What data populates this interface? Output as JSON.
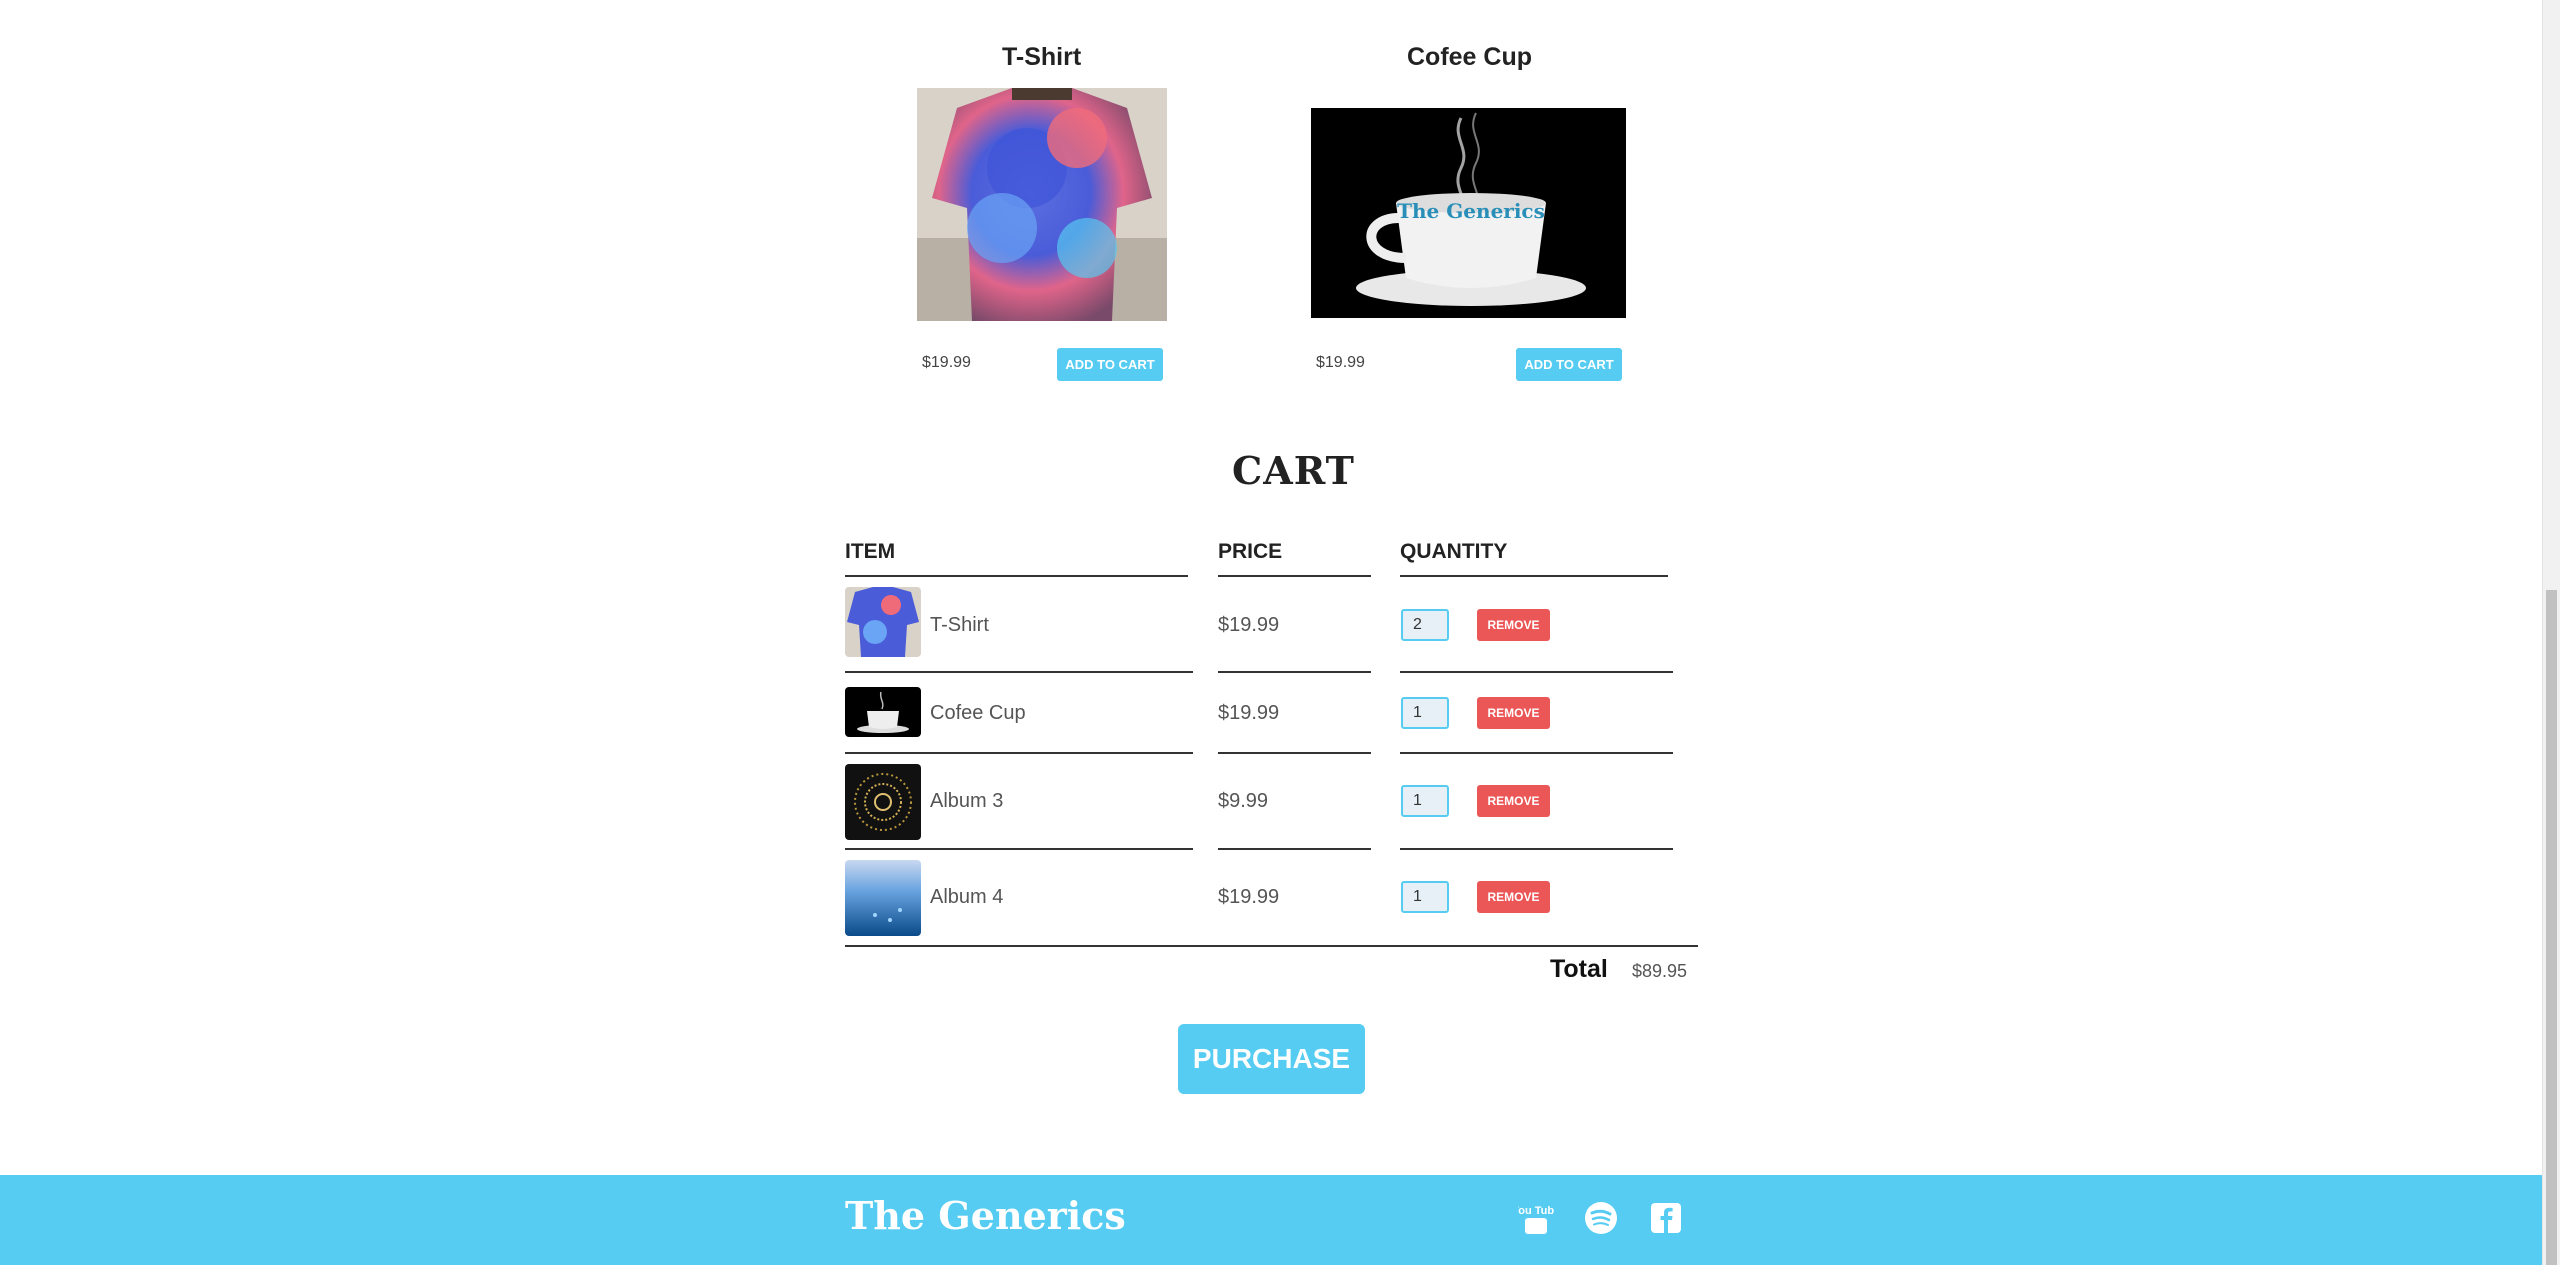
{
  "products": [
    {
      "title": "T-Shirt",
      "price": "$19.99",
      "button": "ADD TO CART"
    },
    {
      "title": "Cofee Cup",
      "price": "$19.99",
      "button": "ADD TO CART"
    }
  ],
  "cart": {
    "heading": "CART",
    "columns": {
      "item": "ITEM",
      "price": "PRICE",
      "quantity": "QUANTITY"
    },
    "rows": [
      {
        "name": "T-Shirt",
        "price": "$19.99",
        "quantity": "2",
        "remove": "REMOVE"
      },
      {
        "name": "Cofee Cup",
        "price": "$19.99",
        "quantity": "1",
        "remove": "REMOVE"
      },
      {
        "name": "Album 3",
        "price": "$9.99",
        "quantity": "1",
        "remove": "REMOVE"
      },
      {
        "name": "Album 4",
        "price": "$19.99",
        "quantity": "1",
        "remove": "REMOVE"
      }
    ],
    "total_label": "Total",
    "total_value": "$89.95",
    "purchase_button": "PURCHASE"
  },
  "footer": {
    "brand": "The Generics",
    "social_icons": [
      "youtube-icon",
      "spotify-icon",
      "facebook-icon"
    ],
    "youtube_text": "You Tube"
  },
  "colors": {
    "accent": "#56CCF2",
    "danger": "#EB5757"
  }
}
